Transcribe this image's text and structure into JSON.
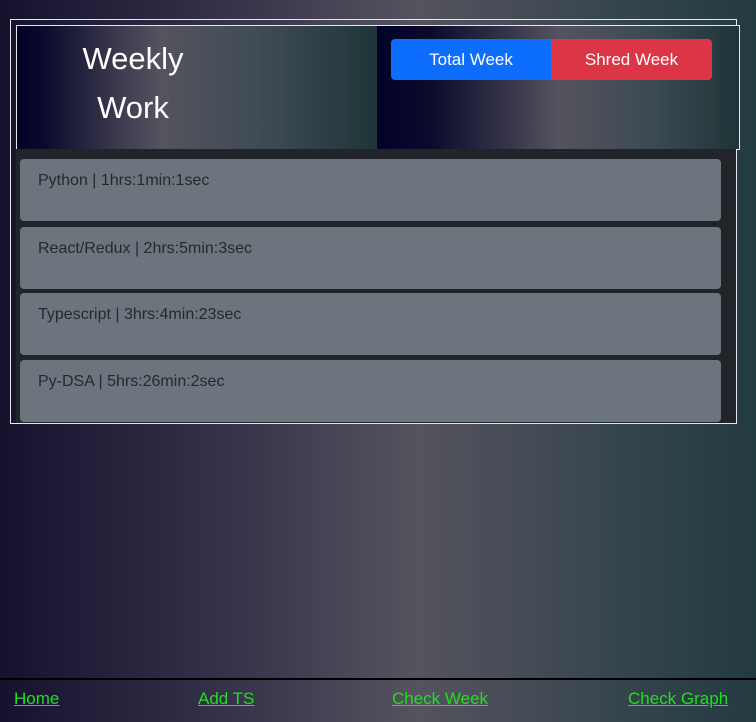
{
  "header": {
    "title_line1": "Weekly",
    "title_line2": "Work",
    "total_week_label": "Total Week",
    "shred_week_label": "Shred Week"
  },
  "items": [
    {
      "label": "Python | 1hrs:1min:1sec"
    },
    {
      "label": "React/Redux | 2hrs:5min:3sec"
    },
    {
      "label": "Typescript | 3hrs:4min:23sec"
    },
    {
      "label": "Py-DSA | 5hrs:26min:2sec"
    }
  ],
  "footer": {
    "links": [
      "Home",
      "Add TS",
      "Check Week",
      "Check Graph"
    ]
  },
  "colors": {
    "primary": "#0d6efd",
    "danger": "#dc3545",
    "link": "#1ee01e",
    "item_bg": "#6c757d"
  }
}
